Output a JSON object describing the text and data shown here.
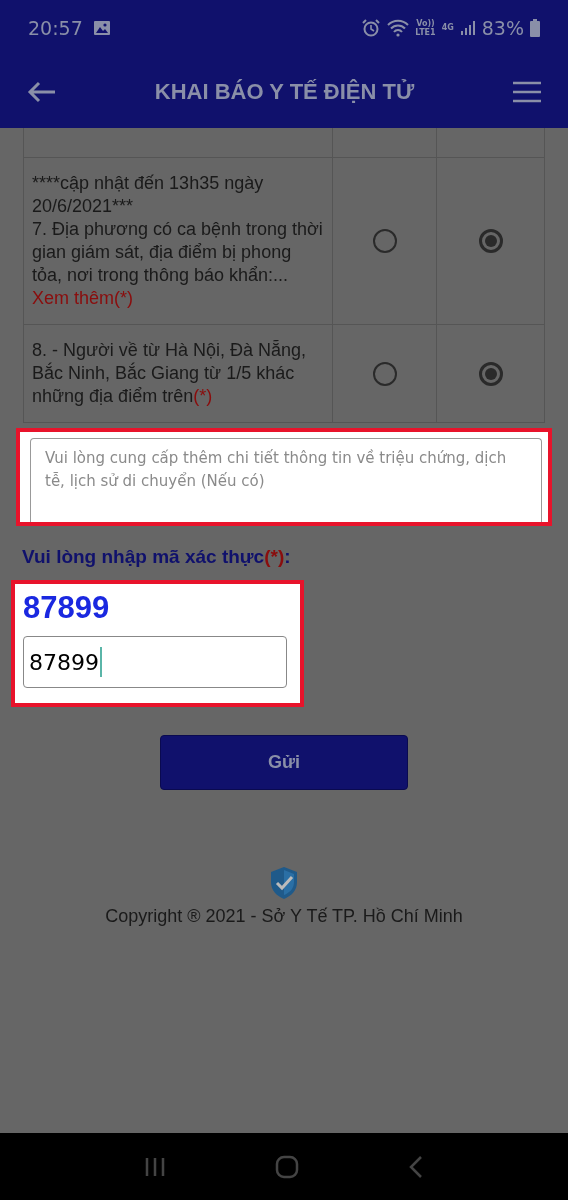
{
  "status_bar": {
    "time": "20:57",
    "volte": "Vo))",
    "lte": "LTE1",
    "network": "4G",
    "battery": "83%"
  },
  "header": {
    "title": "KHAI BÁO Y TẾ ĐIỆN TỬ"
  },
  "questions": [
    {
      "cut": true
    },
    {
      "cut": false,
      "note": "****cập nhật đến 13h35 ngày 20/6/2021***",
      "text": "7. Địa phương có ca bệnh trong thời gian giám sát, địa điểm bị phong tỏa, nơi trong thông báo khẩn:...",
      "more_link": "Xem thêm(*)",
      "options": [
        {
          "selected": false
        },
        {
          "selected": true
        }
      ]
    },
    {
      "cut": false,
      "text": "8. - Người về từ Hà Nội, Đà Nẵng, Bắc Ninh, Bắc Giang từ 1/5 khác những địa điểm trên",
      "required_mark": "(*)",
      "options": [
        {
          "selected": false
        },
        {
          "selected": true
        }
      ]
    }
  ],
  "details": {
    "placeholder": "Vui lòng cung cấp thêm chi tiết thông tin về triệu chứng, dịch tễ, lịch sử di chuyển (Nếu có)",
    "highlighted": true
  },
  "captcha": {
    "label": "Vui lòng nhập mã xác thực",
    "required_mark": "(*)",
    "colon": ":",
    "code": "87899",
    "value": "87899",
    "highlighted": true
  },
  "submit": {
    "label": "Gửi"
  },
  "footer": {
    "copyright": "Copyright ® 2021 - Sở Y Tế TP. Hồ Chí Minh"
  }
}
